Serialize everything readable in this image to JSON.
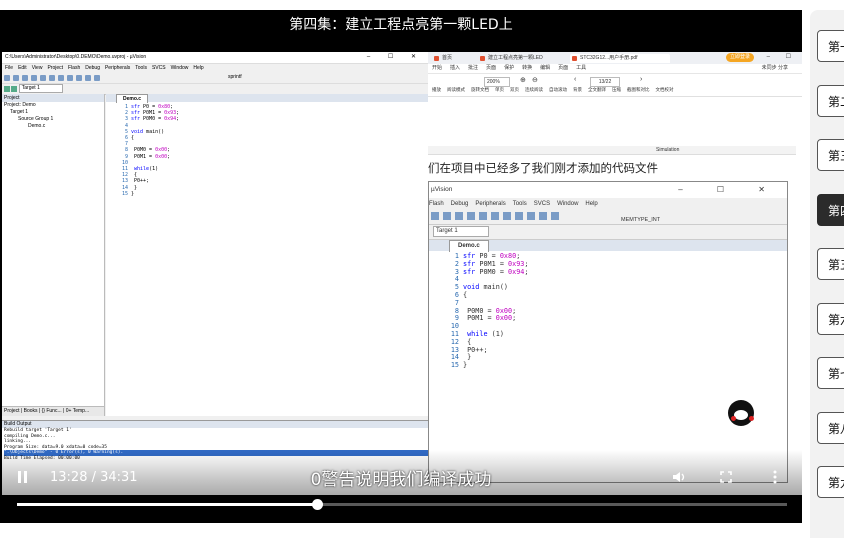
{
  "video": {
    "title": "第四集：建立工程点亮第一颗LED上",
    "subtitle": "0警告说明我们编译成功",
    "time": "13:28 / 34:31",
    "progress": 0.39
  },
  "uvision": {
    "window_title": "C:\\Users\\Administrator\\Desktop\\0.DEMO\\Demo.uvproj - µVision",
    "menu": [
      "File",
      "Edit",
      "View",
      "Project",
      "Flash",
      "Debug",
      "Peripherals",
      "Tools",
      "SVCS",
      "Window",
      "Help"
    ],
    "toolbar_func": "sprintf",
    "target": "Target 1",
    "project_header": "Project",
    "tree": [
      "Project: Demo",
      "Target 1",
      "Source Group 1",
      "Demo.c"
    ],
    "bottom_tabs": "Project | Books | {} Func... | 0+ Temp...",
    "editor_tab": "Demo.c",
    "code": [
      {
        "n": "1",
        "t": "sfr P0 = 0x80;"
      },
      {
        "n": "2",
        "t": "sfr P0M1 = 0x93;"
      },
      {
        "n": "3",
        "t": "sfr P0M0 = 0x94;"
      },
      {
        "n": "4",
        "t": ""
      },
      {
        "n": "5",
        "t": "void main()"
      },
      {
        "n": "6",
        "t": "{"
      },
      {
        "n": "7",
        "t": ""
      },
      {
        "n": "8",
        "t": "    P0M0 = 0x00;"
      },
      {
        "n": "9",
        "t": "    P0M1 = 0x00;"
      },
      {
        "n": "10",
        "t": ""
      },
      {
        "n": "11",
        "t": "    while(1)"
      },
      {
        "n": "12",
        "t": "    {"
      },
      {
        "n": "13",
        "t": "        P0++;"
      },
      {
        "n": "14",
        "t": "    }"
      },
      {
        "n": "15",
        "t": "}"
      }
    ],
    "build_header": "Build Output",
    "build_lines": [
      "Rebuild target 'Target 1'",
      "compiling Demo.c...",
      "linking...",
      "Program Size: data=9.0 xdata=0 code=35",
      "\".\\Objects\\Demo\" - 0 Error(s), 0 Warning(s).",
      "Build Time Elapsed: 00:00:00"
    ]
  },
  "pdf": {
    "tabs": [
      "首页",
      "建立工程点亮第一颗LED",
      "STC32G12...用户手册.pdf"
    ],
    "login": "立即登录",
    "menu": [
      "开始",
      "插入",
      "批注",
      "页面",
      "保护",
      "转换",
      "编辑",
      "页面",
      "工具"
    ],
    "menu_right": "未同步 分享",
    "zoom": "200%",
    "page": "13/22",
    "tool_row": [
      "播放",
      "阅读模式",
      "旋转文档",
      "单页",
      "双页",
      "连续阅读",
      "自动滚动",
      "背景",
      "全文翻译",
      "压缩",
      "截图和对比",
      "文档校对"
    ],
    "sim_label": "Simulation",
    "caption": "们在项目中已经多了我们刚才添加的代码文件",
    "inset": {
      "title": "µVision",
      "menu": [
        "Flash",
        "Debug",
        "Peripherals",
        "Tools",
        "SVCS",
        "Window",
        "Help"
      ],
      "toolbar_dd": "MEMTYPE_INT",
      "target": "Target 1",
      "tab": "Demo.c",
      "code": [
        {
          "n": "1",
          "t": "sfr P0     =    0x80;"
        },
        {
          "n": "2",
          "t": "sfr P0M1   =    0x93;"
        },
        {
          "n": "3",
          "t": "sfr P0M0   =    0x94;"
        },
        {
          "n": "4",
          "t": ""
        },
        {
          "n": "5",
          "t": "void main()"
        },
        {
          "n": "6",
          "t": "{"
        },
        {
          "n": "7",
          "t": ""
        },
        {
          "n": "8",
          "t": "    P0M0 = 0x00;"
        },
        {
          "n": "9",
          "t": "    P0M1 = 0x00;"
        },
        {
          "n": "10",
          "t": ""
        },
        {
          "n": "11",
          "t": "    while (1)"
        },
        {
          "n": "12",
          "t": "    {"
        },
        {
          "n": "13",
          "t": "        P0++;"
        },
        {
          "n": "14",
          "t": "    }"
        },
        {
          "n": "15",
          "t": "}"
        }
      ]
    }
  },
  "episodes": [
    {
      "label": "第一集",
      "active": false
    },
    {
      "label": "第二集",
      "active": false
    },
    {
      "label": "第三集",
      "active": false
    },
    {
      "label": "第四集",
      "active": true
    },
    {
      "label": "第五集",
      "active": false
    },
    {
      "label": "第六集",
      "active": false
    },
    {
      "label": "第七集",
      "active": false
    },
    {
      "label": "第八集",
      "active": false
    },
    {
      "label": "第九集",
      "active": false
    }
  ],
  "colors": {
    "accent": "#ffffff",
    "code_keyword": "#0000ff",
    "code_number": "#c000c0",
    "selection": "#316ac5"
  }
}
